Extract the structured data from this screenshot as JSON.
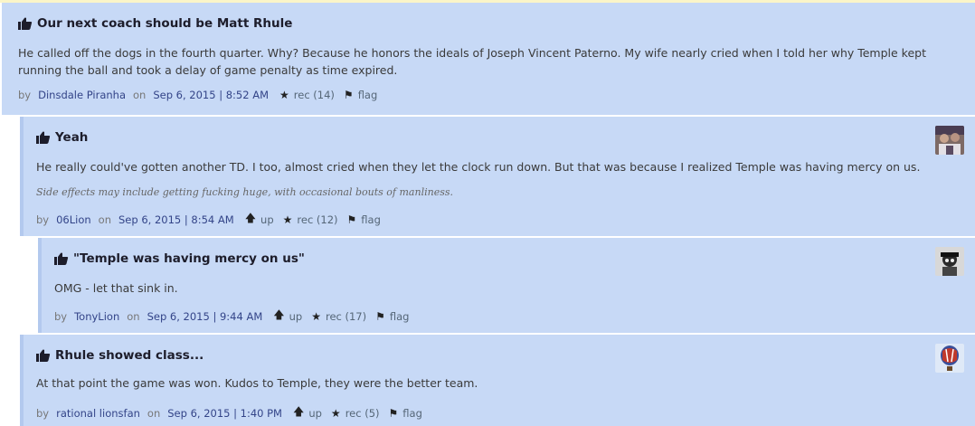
{
  "comments": [
    {
      "title": "Our next coach should be Matt Rhule",
      "body": "He called off the dogs in the fourth quarter. Why? Because he honors the ideals of Joseph Vincent Paterno. My wife nearly cried when I told her why Temple kept running the ball and took a delay of game penalty as time expired.",
      "by": "by",
      "author": "Dinsdale Piranha",
      "on": "on",
      "date": "Sep 6, 2015 | 8:52 AM",
      "rec": "rec (14)",
      "flag": "flag"
    },
    {
      "title": "Yeah",
      "body": "He really could've gotten another TD. I too, almost cried when they let the clock run down. But that was because I realized Temple was having mercy on us.",
      "signature": "Side effects may include getting fucking huge, with occasional bouts of manliness.",
      "by": "by",
      "author": "06Lion",
      "on": "on",
      "date": "Sep 6, 2015 | 8:54 AM",
      "up": "up",
      "rec": "rec (12)",
      "flag": "flag"
    },
    {
      "title": "\"Temple was having mercy on us\"",
      "body": "OMG - let that sink in.",
      "by": "by",
      "author": "TonyLion",
      "on": "on",
      "date": "Sep 6, 2015 | 9:44 AM",
      "up": "up",
      "rec": "rec (17)",
      "flag": "flag"
    },
    {
      "title": "Rhule showed class...",
      "body": "At that point the game was won. Kudos to Temple, they were the better team.",
      "by": "by",
      "author": "rational lionsfan",
      "on": "on",
      "date": "Sep 6, 2015 | 1:40 PM",
      "up": "up",
      "rec": "rec (5)",
      "flag": "flag"
    }
  ],
  "icons": {
    "thumb": "thumbs-up-icon",
    "up": "arrow-up-icon",
    "rec": "star-icon",
    "flag": "flag-icon"
  },
  "colors": {
    "comment_bg": "#c7d9f6",
    "thread_bar": "#b3c9ee",
    "link": "#334488"
  }
}
